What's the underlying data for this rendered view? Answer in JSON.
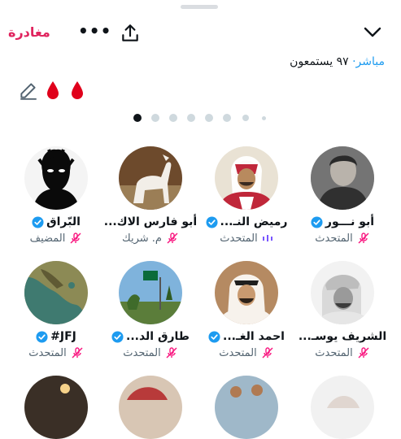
{
  "header": {
    "leave_label": "مغادرة",
    "more_label": "•••",
    "share_icon": "share-icon",
    "collapse_icon": "chevron-down-icon"
  },
  "status": {
    "live_label": "مباشر",
    "separator": "·",
    "listeners": "٩٧ يستمعون"
  },
  "reactions": {
    "edit_icon": "edit-pencil-icon",
    "drops": [
      "blood-drop-icon",
      "blood-drop-icon"
    ]
  },
  "pager": {
    "count": 8,
    "active_index": 0
  },
  "participants": [
    {
      "name": "أبو نـــور",
      "role": "المتحدث",
      "verified": true,
      "mic": "muted"
    },
    {
      "name": "رميض النـ...",
      "role": "المتحدث",
      "verified": true,
      "mic": "speaking"
    },
    {
      "name": "أبو فارس الاك...",
      "role": "م. شريك",
      "verified": false,
      "mic": "muted"
    },
    {
      "name": "البّراق",
      "role": "المضيف",
      "verified": true,
      "mic": "muted"
    },
    {
      "name": "الشريف يوسـ...",
      "role": "المتحدث",
      "verified": false,
      "mic": "muted"
    },
    {
      "name": "احمد الغـ...",
      "role": "المتحدث",
      "verified": true,
      "mic": "muted"
    },
    {
      "name": "طارق الد...",
      "role": "المتحدث",
      "verified": true,
      "mic": "muted"
    },
    {
      "name": "JFJ#",
      "role": "المتحدث",
      "verified": true,
      "mic": "muted"
    }
  ],
  "colors": {
    "accent_blue": "#1d9bf0",
    "leave_red": "#e0245e",
    "mic_pink": "#f91880",
    "drop_red": "#e0001b"
  }
}
